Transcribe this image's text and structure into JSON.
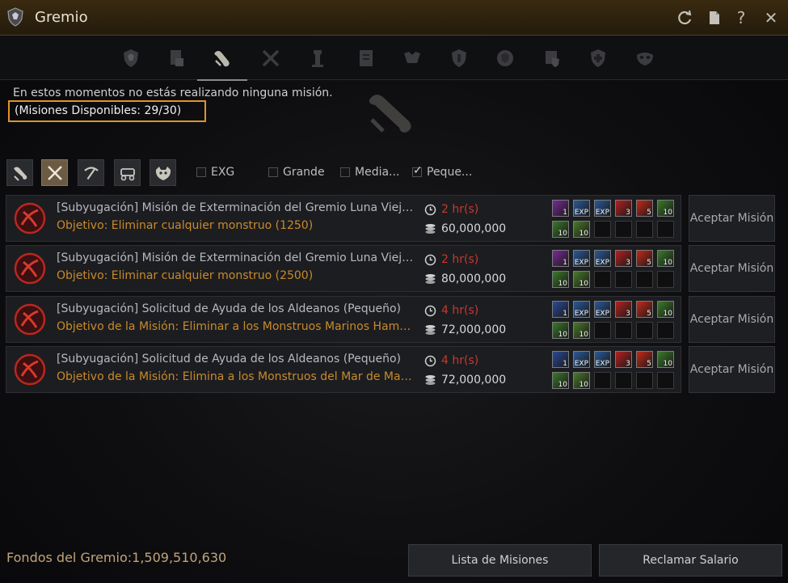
{
  "window": {
    "title": "Gremio",
    "icons": [
      "guild-shield-icon",
      "refresh-icon",
      "document-icon",
      "help-icon",
      "close-icon"
    ],
    "help_glyph": "?",
    "close_glyph": "✕"
  },
  "tabs": {
    "active_index": 2,
    "items": [
      "guild-crest-icon",
      "guild-info-icon",
      "quest-scroll-icon",
      "war-swords-icon",
      "tower-icon",
      "notice-board-icon",
      "guild-league-icon",
      "fortress-shield-icon",
      "occupation-icon",
      "alliance-icon",
      "medic-shield-icon",
      "mask-icon"
    ]
  },
  "status": {
    "message": "En estos momentos no estás realizando ninguna misión.",
    "available": "(Misiones Disponibles: 29/30)"
  },
  "filters": {
    "categories": [
      "gathering-icon",
      "combat-crossed-swords-icon",
      "pickaxe-icon",
      "wagon-icon",
      "monster-icon"
    ],
    "active_category": 1,
    "checks": [
      {
        "label": "EXG",
        "checked": false
      },
      {
        "label": "Grande",
        "checked": false
      },
      {
        "label": "Media...",
        "checked": false
      },
      {
        "label": "Peque...",
        "checked": true
      }
    ]
  },
  "missions": [
    {
      "title": "[Subyugación] Misión de Exterminación del Gremio Luna Vieja (Pequeño)",
      "goal": "Objetivo: Eliminar cualquier monstruo (1250)",
      "time": "2  hr(s)",
      "price": "60,000,000",
      "accept": "Aceptar Misión",
      "rewards": [
        {
          "color": "#7a2a9a",
          "qty": "1"
        },
        {
          "color": "#2a5a9a",
          "qty": "EXP"
        },
        {
          "color": "#2a5a9a",
          "qty": "EXP"
        },
        {
          "color": "#b82020",
          "qty": "3"
        },
        {
          "color": "#c82818",
          "qty": "5"
        },
        {
          "color": "#3a7a2a",
          "qty": "10"
        },
        {
          "color": "#3a7a2a",
          "qty": "10"
        },
        {
          "color": "#4a7a2a",
          "qty": "10"
        }
      ]
    },
    {
      "title": "[Subyugación] Misión de Exterminación del Gremio Luna Vieja (Pequeño)",
      "goal": "Objetivo: Eliminar cualquier monstruo (2500)",
      "time": "2  hr(s)",
      "price": "80,000,000",
      "accept": "Aceptar Misión",
      "rewards": [
        {
          "color": "#7a2a9a",
          "qty": "1"
        },
        {
          "color": "#2a5a9a",
          "qty": "EXP"
        },
        {
          "color": "#2a5a9a",
          "qty": "EXP"
        },
        {
          "color": "#b82020",
          "qty": "3"
        },
        {
          "color": "#c82818",
          "qty": "5"
        },
        {
          "color": "#3a7a2a",
          "qty": "10"
        },
        {
          "color": "#3a7a2a",
          "qty": "10"
        },
        {
          "color": "#4a7a2a",
          "qty": "10"
        }
      ]
    },
    {
      "title": "[Subyugación] Solicitud de Ayuda de los Aldeanos (Pequeño)",
      "goal": "Objetivo de la Misión: Eliminar a los Monstruos Marinos Hambrientos",
      "time": "4  hr(s)",
      "price": "72,000,000",
      "accept": "Aceptar Misión",
      "rewards": [
        {
          "color": "#2a4a9a",
          "qty": "1"
        },
        {
          "color": "#2a5a9a",
          "qty": "EXP"
        },
        {
          "color": "#2a5a9a",
          "qty": "EXP"
        },
        {
          "color": "#b82020",
          "qty": "3"
        },
        {
          "color": "#c82818",
          "qty": "5"
        },
        {
          "color": "#3a7a2a",
          "qty": "10"
        },
        {
          "color": "#3a7a2a",
          "qty": "10"
        },
        {
          "color": "#4a7a2a",
          "qty": "10"
        }
      ]
    },
    {
      "title": "[Subyugación] Solicitud de Ayuda de los Aldeanos (Pequeño)",
      "goal": "Objetivo de la Misión: Elimina a los Monstruos del Mar de Margoria",
      "time": "4  hr(s)",
      "price": "72,000,000",
      "accept": "Aceptar Misión",
      "rewards": [
        {
          "color": "#2a4a9a",
          "qty": "1"
        },
        {
          "color": "#2a5a9a",
          "qty": "EXP"
        },
        {
          "color": "#2a5a9a",
          "qty": "EXP"
        },
        {
          "color": "#b82020",
          "qty": "3"
        },
        {
          "color": "#c82818",
          "qty": "5"
        },
        {
          "color": "#3a7a2a",
          "qty": "10"
        },
        {
          "color": "#3a7a2a",
          "qty": "10"
        },
        {
          "color": "#4a7a2a",
          "qty": "10"
        }
      ]
    }
  ],
  "footer": {
    "funds": "Fondos del Gremio:1,509,510,630",
    "list_button": "Lista de Misiones",
    "salary_button": "Reclamar Salario"
  }
}
